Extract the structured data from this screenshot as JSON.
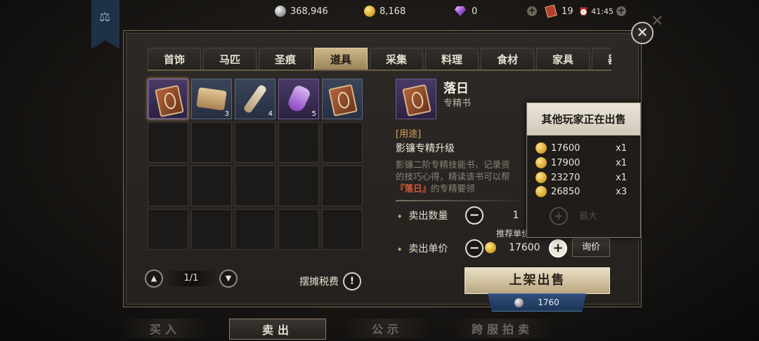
{
  "topbar": {
    "silver": "368,946",
    "gold": "8,168",
    "gems": "0",
    "tickets": "19",
    "time": "41:45"
  },
  "tabs": [
    "首饰",
    "马匹",
    "圣痕",
    "道具",
    "采集",
    "料理",
    "食材",
    "家具",
    "器械"
  ],
  "active_tab": 3,
  "inventory": {
    "items": [
      {
        "icon": "skill-book-icon",
        "count": ""
      },
      {
        "icon": "scroll-map-icon",
        "count": "3"
      },
      {
        "icon": "bottle-icon",
        "count": "4"
      },
      {
        "icon": "potion-icon",
        "count": "5"
      },
      {
        "icon": "skill-book-blue-icon",
        "count": ""
      }
    ],
    "page": "1/1"
  },
  "tax_label": "摆摊税费",
  "detail": {
    "name": "落日",
    "type": "专精书",
    "usage_tag": "[用途]",
    "usage": "影镰专精升级",
    "desc_line1": "影镰二阶专精技能书，记录资",
    "desc_line2": "的技巧心得，精读该书可以帮",
    "desc_highlight": "『落日』",
    "desc_line3": "的专精要领"
  },
  "sell": {
    "qty_label": "卖出数量",
    "qty": "1",
    "recommend_label": "推荐单价",
    "price_label": "卖出单价",
    "price": "17600",
    "inquire_label": "询价",
    "list_button": "上架出售",
    "fee": "1760"
  },
  "popup": {
    "title": "其他玩家正在出售",
    "rows": [
      {
        "price": "17600",
        "qty": "x1"
      },
      {
        "price": "17900",
        "qty": "x1"
      },
      {
        "price": "23270",
        "qty": "x1"
      },
      {
        "price": "26850",
        "qty": "x3"
      }
    ],
    "max_label": "最大"
  },
  "nav": {
    "buy": "买入",
    "sell": "卖出",
    "notice": "公示",
    "cross": "跨服拍卖"
  },
  "colors": {
    "accent_gold": "#cdb68a",
    "highlight_red": "#d65a3a",
    "usage_orange": "#d9a457"
  }
}
